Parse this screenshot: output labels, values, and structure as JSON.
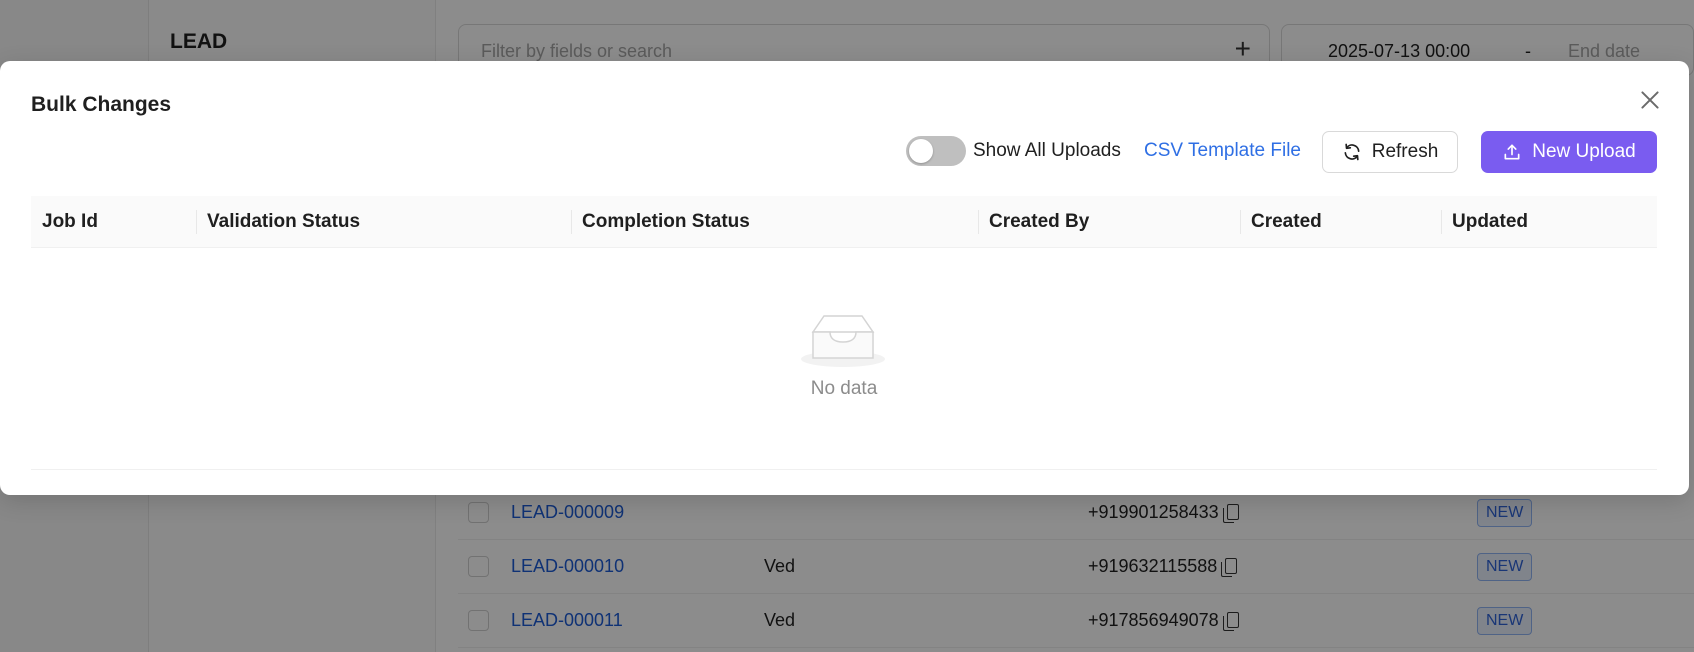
{
  "background": {
    "sidebar_title": "LEAD",
    "filter": {
      "placeholder": "Filter by fields or search"
    },
    "date_range": {
      "start": "2025-07-13 00:00",
      "separator": "-",
      "end_placeholder": "End date"
    },
    "rows": [
      {
        "lead_id": "LEAD-000009",
        "name": "",
        "phone": "+919901258433",
        "status": "NEW"
      },
      {
        "lead_id": "LEAD-000010",
        "name": "Ved",
        "phone": "+919632115588",
        "status": "NEW"
      },
      {
        "lead_id": "LEAD-000011",
        "name": "Ved",
        "phone": "+917856949078",
        "status": "NEW"
      }
    ]
  },
  "modal": {
    "title": "Bulk Changes",
    "toggle": {
      "label": "Show All Uploads",
      "on": false
    },
    "csv_link": "CSV Template File",
    "refresh_label": "Refresh",
    "upload_label": "New Upload",
    "accent_color": "#7a5cf0",
    "table": {
      "columns": [
        "Job Id",
        "Validation Status",
        "Completion Status",
        "Created By",
        "Created",
        "Updated"
      ],
      "empty_text": "No data"
    }
  }
}
